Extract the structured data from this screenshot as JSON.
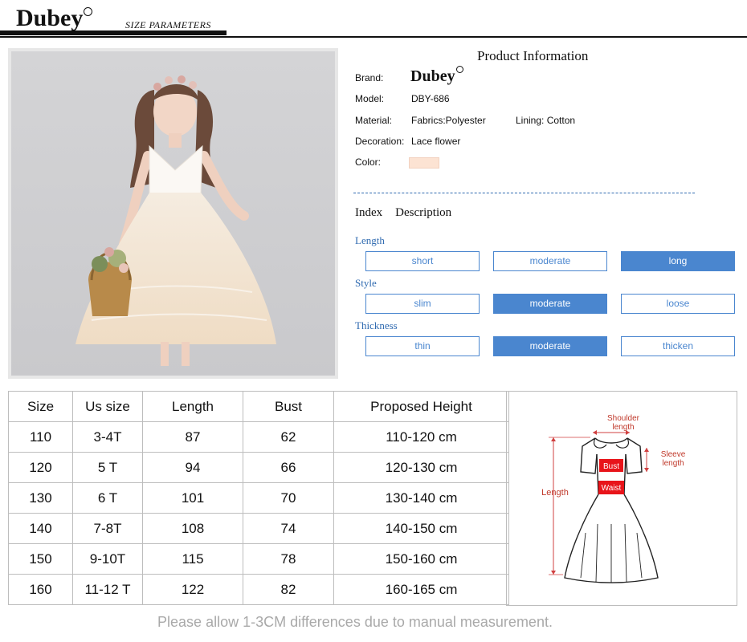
{
  "header": {
    "logo_text": "Dubey",
    "section_title": "SIZE  PARAMETERS"
  },
  "product": {
    "title": "Product  Information",
    "brand_label": "Brand:",
    "brand_value": "Dubey",
    "model_label": "Model:",
    "model_value": "DBY-686",
    "material_label": "Material:",
    "material_value": "Fabrics:Polyester",
    "lining_value": "Lining: Cotton",
    "decoration_label": "Decoration:",
    "decoration_value": "Lace flower",
    "color_label": "Color:",
    "color_swatch": "#fce3d3"
  },
  "index": {
    "index_label": "Index",
    "description_label": "Description",
    "categories": [
      {
        "label": "Length",
        "options": [
          "short",
          "moderate",
          "long"
        ],
        "selected": 2
      },
      {
        "label": "Style",
        "options": [
          "slim",
          "moderate",
          "loose"
        ],
        "selected": 1
      },
      {
        "label": "Thickness",
        "options": [
          "thin",
          "moderate",
          "thicken"
        ],
        "selected": 1
      }
    ],
    "accent_color": "#4a86cf"
  },
  "size_table": {
    "headers": [
      "Size",
      "Us size",
      "Length",
      "Bust",
      "Proposed Height"
    ],
    "rows": [
      [
        "110",
        "3-4T",
        "87",
        "62",
        "110-120 cm"
      ],
      [
        "120",
        "5 T",
        "94",
        "66",
        "120-130 cm"
      ],
      [
        "130",
        "6 T",
        "101",
        "70",
        "130-140 cm"
      ],
      [
        "140",
        "7-8T",
        "108",
        "74",
        "140-150 cm"
      ],
      [
        "150",
        "9-10T",
        "115",
        "78",
        "150-160 cm"
      ],
      [
        "160",
        "11-12 T",
        "122",
        "82",
        "160-165 cm"
      ]
    ]
  },
  "diagram": {
    "shoulder_label": "Shoulder length",
    "shoulder_line1": "Shoulder",
    "shoulder_line2": "length",
    "sleeve_line1": "Sleeve",
    "sleeve_line2": "length",
    "length_label": "Length",
    "bust_label": "Bust",
    "waist_label": "Waist"
  },
  "footnote": "Please allow 1-3CM differences due to manual measurement."
}
